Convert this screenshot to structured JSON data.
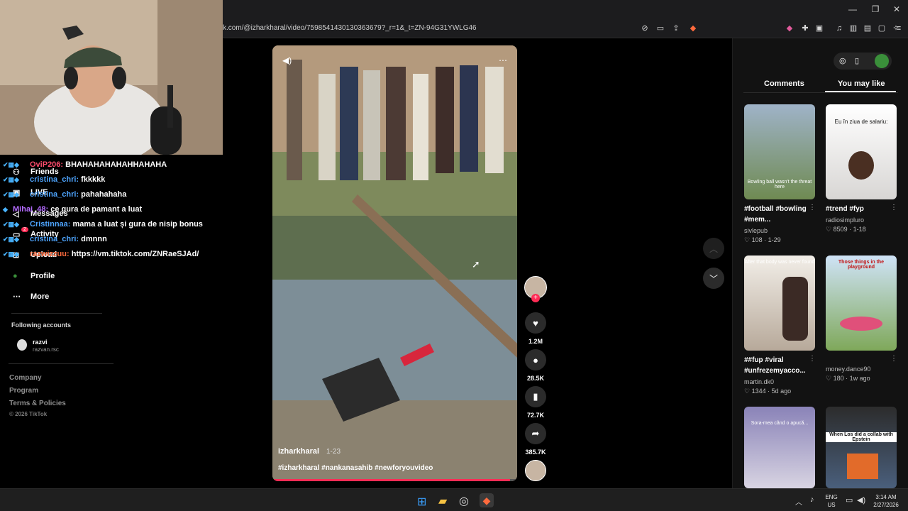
{
  "browser": {
    "url": "k.com/@izharkharal/video/7598541430130363679?_r=1&_t=ZN-94G31YWLG46"
  },
  "sidebar": {
    "items": [
      {
        "label": "Friends",
        "icon": "friends-icon"
      },
      {
        "label": "LIVE",
        "icon": "live-icon"
      },
      {
        "label": "Messages",
        "icon": "messages-icon"
      },
      {
        "label": "Activity",
        "icon": "activity-icon",
        "badge": "2"
      },
      {
        "label": "Upload",
        "icon": "upload-icon"
      },
      {
        "label": "Profile",
        "icon": "profile-icon"
      },
      {
        "label": "More",
        "icon": "more-icon"
      }
    ],
    "following_title": "Following accounts",
    "following": [
      {
        "name": "razvi",
        "handle": "razvan.rsc"
      }
    ],
    "footer": [
      "Company",
      "Program",
      "Terms & Policies",
      "© 2026 TikTok"
    ]
  },
  "chat": {
    "lines": [
      {
        "user": "OviP206:",
        "text": "BHAHAHAHAHAHHAHAHA",
        "color": "#ff4d6d"
      },
      {
        "user": "cristina_chri:",
        "text": "fkkkkk",
        "color": "#4ea5ff"
      },
      {
        "user": "cristina_chri:",
        "text": "pahahahaha",
        "color": "#4ea5ff"
      },
      {
        "user": "Mihai_48:",
        "text": "ce gura de pamant a luat",
        "color": "#b46cff"
      },
      {
        "user": "Cristinnaa:",
        "text": "mama a luat și gura de nisip bonus",
        "color": "#4ea5ff"
      },
      {
        "user": "cristina_chri:",
        "text": "dmnnn",
        "color": "#4ea5ff"
      },
      {
        "user": "razwizzuu:",
        "text": "https://vm.tiktok.com/ZNRaeSJAd/",
        "color": "#ff6a3d"
      }
    ]
  },
  "video": {
    "author": "izharkharal",
    "date": "1-23",
    "caption": "#izharkharal #nankanasahib #newforyouvideo",
    "progress": 0.97
  },
  "actions": {
    "likes": "1.2M",
    "comments": "28.5K",
    "saves": "72.7K",
    "shares": "385.7K"
  },
  "panel": {
    "tabs": [
      "Comments",
      "You may like"
    ],
    "active_tab": "You may like",
    "cards": [
      {
        "title": "#football #bowling #mem...",
        "author": "sivlepub",
        "likes": "108",
        "date": "1-29",
        "thumb_text": "Bowling ball wasn't the threat here"
      },
      {
        "title": "#trend #fyp",
        "author": "radiosimpluro",
        "likes": "8509",
        "date": "1-18",
        "thumb_text": "Eu în ziua de salariu:"
      },
      {
        "title": "##fup #viral #unfrezemyacco...",
        "author": "martin.dk0",
        "likes": "1344",
        "date": "5d ago",
        "thumb_text": "After that body was never found"
      },
      {
        "title": "",
        "author": "money.dance90",
        "likes": "180",
        "date": "1w ago",
        "thumb_text": "Those things in the playground"
      },
      {
        "title": "",
        "author": "",
        "likes": "",
        "date": "",
        "thumb_text": "Sora-mea când o apucă..."
      },
      {
        "title": "",
        "author": "",
        "likes": "",
        "date": "",
        "thumb_text": "When Los did a collab with Epstein"
      }
    ]
  },
  "taskbar": {
    "lang": "ENG",
    "region": "US",
    "time": "3:14 AM",
    "date": "2/27/2026"
  }
}
